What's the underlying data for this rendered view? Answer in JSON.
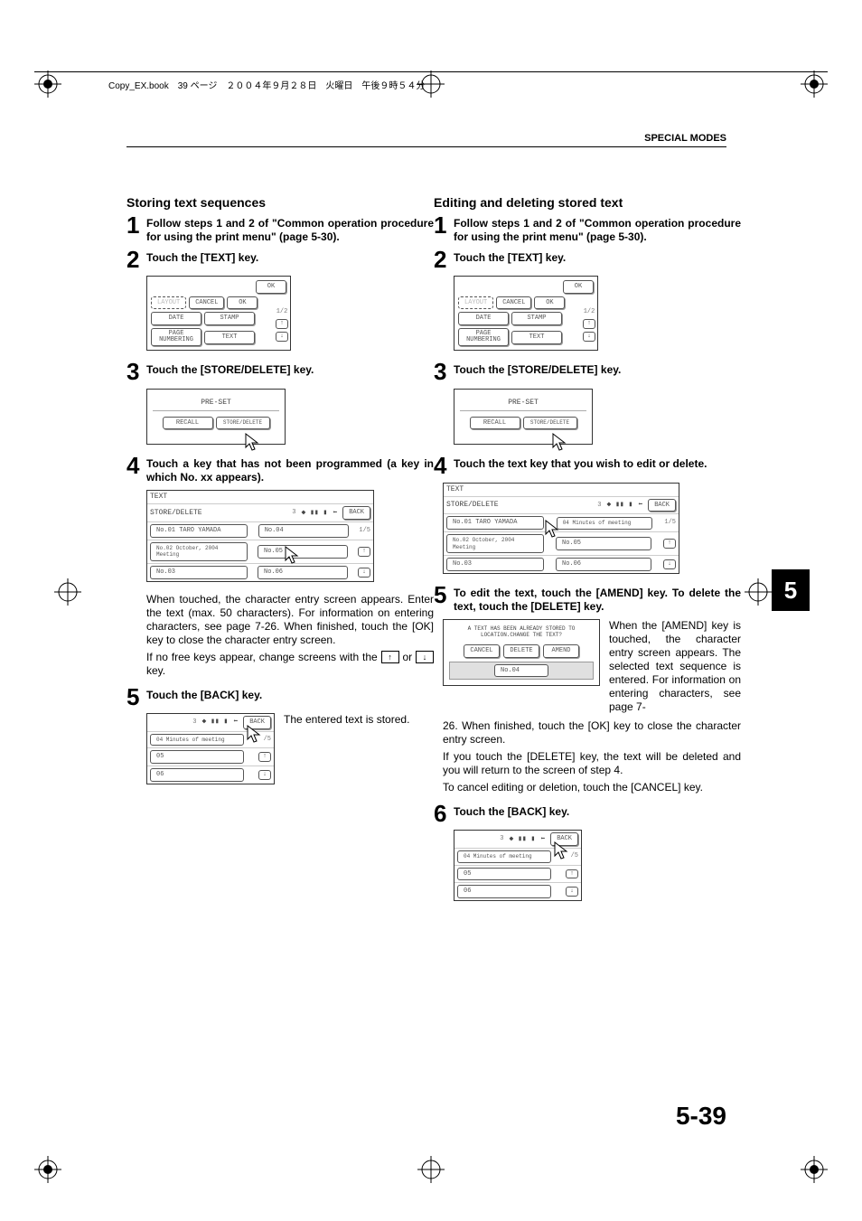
{
  "header": {
    "crop_note": "Copy_EX.book　39 ページ　２００４年９月２８日　火曜日　午後９時５４分",
    "section": "SPECIAL MODES"
  },
  "tab": "5",
  "page_number": "5-39",
  "left": {
    "title": "Storing text sequences",
    "step1": "Follow steps 1 and 2 of \"Common operation procedure for using the print menu\" (page 5-30).",
    "step2": "Touch the [TEXT] key.",
    "step3": "Touch the [STORE/DELETE] key.",
    "step4": "Touch a key that has not been programmed (a key in which No. xx appears).",
    "step4_para": "When touched, the character entry screen appears. Enter the text (max. 50 characters). For information on entering characters, see page 7-26. When finished, touch the [OK] key to close the character entry screen.",
    "step4_para2a": "If no free keys appear, change screens with the ",
    "step4_para2b": " or ",
    "step4_para2c": " key.",
    "step5": "Touch the [BACK] key.",
    "step5_side": "The entered text is stored."
  },
  "right": {
    "title": "Editing and deleting stored text",
    "step1": "Follow steps 1 and 2 of \"Common operation procedure for using the print menu\" (page 5-30).",
    "step2": "Touch the [TEXT] key.",
    "step3": "Touch the [STORE/DELETE] key.",
    "step4": "Touch the text key that you wish to edit or delete.",
    "step5": "To edit the text, touch the [AMEND] key. To delete the text, touch the [DELETE] key.",
    "step5_side": "When the [AMEND] key is touched, the character entry screen appears. The selected text sequence is entered. For information on entering characters, see page 7-",
    "step5_para2": "26. When finished, touch the [OK] key to close the character entry screen.",
    "step5_para3": "If you touch the [DELETE] key, the text will be deleted and you will return to the screen of step 4.",
    "step5_para4": "To cancel editing or deletion, touch the [CANCEL] key.",
    "step6": "Touch the [BACK] key."
  },
  "screens": {
    "menu": {
      "ok": "OK",
      "layout": "LAYOUT",
      "cancel": "CANCEL",
      "ok2": "OK",
      "date": "DATE",
      "stamp": "STAMP",
      "page_numbering": "PAGE NUMBERING",
      "text": "TEXT",
      "frac": "1/2"
    },
    "preset": {
      "title": "PRE-SET",
      "recall": "RECALL",
      "store_delete": "STORE/DELETE"
    },
    "list": {
      "crumb": "TEXT",
      "crumb2": "STORE/DELETE",
      "pager_left": "3",
      "back": "BACK",
      "r1a": "No.01 TARO YAMADA",
      "r1b": "No.04",
      "r1c": "04 Minutes of meeting",
      "frac": "1/5",
      "r2a": "No.02 October, 2004 Meeting",
      "r2b": "No.05",
      "r3a": "No.03",
      "r3b": "No.06"
    },
    "back": {
      "pager_left": "3",
      "back": "BACK",
      "r1": "04 Minutes of meeting",
      "frac": "/5",
      "r2": "05",
      "r3": "06"
    },
    "amend": {
      "msg1": "A TEXT HAS BEEN ALREADY STORED TO",
      "msg2": "LOCATION.CHANGE THE TEXT?",
      "cancel": "CANCEL",
      "delete": "DELETE",
      "amend": "AMEND",
      "row": "No.04"
    }
  }
}
